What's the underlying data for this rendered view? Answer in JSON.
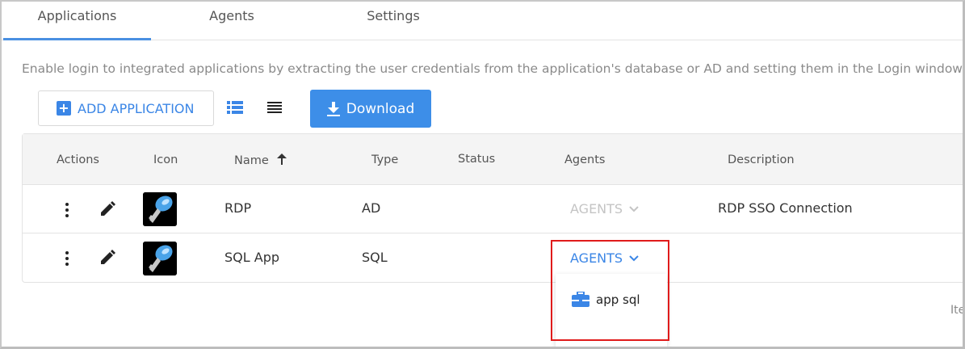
{
  "tabs": [
    {
      "label": "Applications",
      "active": true
    },
    {
      "label": "Agents",
      "active": false
    },
    {
      "label": "Settings",
      "active": false
    }
  ],
  "description": "Enable login to integrated applications by extracting the user credentials from the application's database or AD and setting them in the Login window.",
  "toolbar": {
    "add_label": "ADD APPLICATION",
    "download_label": "Download",
    "view_icons": [
      "list-view-icon",
      "compact-list-icon"
    ]
  },
  "table": {
    "headers": {
      "actions": "Actions",
      "icon": "Icon",
      "name": "Name",
      "type": "Type",
      "status": "Status",
      "agents": "Agents",
      "description": "Description"
    },
    "sort": {
      "column": "Name",
      "direction": "ascending"
    },
    "rows": [
      {
        "name": "RDP",
        "type": "AD",
        "status": "",
        "agents_label": "AGENTS",
        "agents_enabled": false,
        "description": "RDP SSO Connection"
      },
      {
        "name": "SQL App",
        "type": "SQL",
        "status": "",
        "agents_label": "AGENTS",
        "agents_enabled": true,
        "description": ""
      }
    ]
  },
  "agents_menu": {
    "items": [
      {
        "label": "app sql",
        "icon": "briefcase-icon"
      }
    ]
  },
  "footer": {
    "items_label": "Ite"
  },
  "colors": {
    "accent": "#3b86e6",
    "download_bg": "#3d8ee8",
    "highlight": "#e01b1b"
  }
}
